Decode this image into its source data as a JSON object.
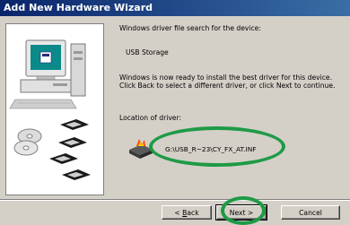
{
  "window": {
    "title": "Add New Hardware Wizard"
  },
  "content": {
    "intro": "Windows driver file search for the device:",
    "device_name": "USB Storage",
    "ready_text": "Windows is now ready to install the best driver for this device. Click Back to select a different driver, or click Next to continue.",
    "location_label": "Location of driver:",
    "driver_path": "G:\\USB_R~23\\CY_FX_AT.INF",
    "driver_icon": "driver-file-icon"
  },
  "buttons": {
    "back_label": "Back",
    "back_prefix": "< ",
    "next_label": "Next >",
    "cancel_label": "Cancel"
  },
  "colors": {
    "title_bar": "#0a246a",
    "highlight_ellipse": "#1f9a46",
    "dialog_bg": "#d4d0c8"
  }
}
